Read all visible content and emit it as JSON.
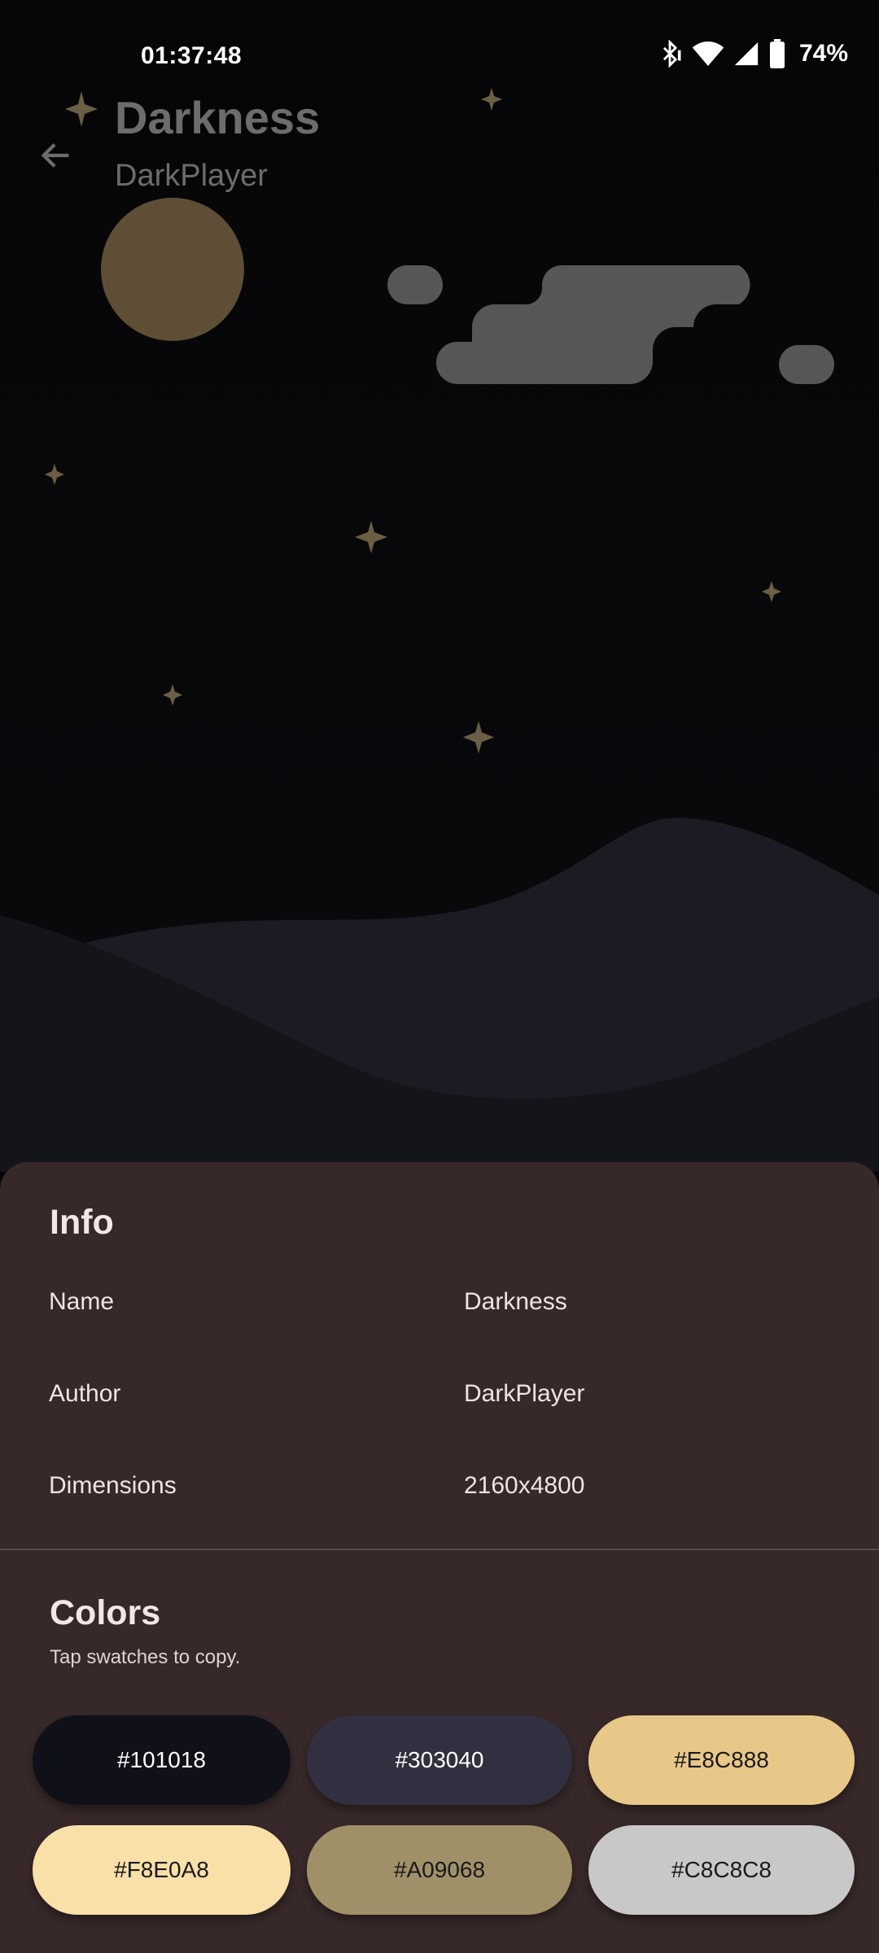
{
  "status_bar": {
    "time": "01:37:48",
    "battery": "74%",
    "icons": [
      "bluetooth-icon",
      "wifi-icon",
      "signal-icon",
      "battery-icon"
    ]
  },
  "header": {
    "back_icon": "arrow-back-icon",
    "title": "Darkness",
    "subtitle": "DarkPlayer"
  },
  "info": {
    "heading": "Info",
    "rows": [
      {
        "label": "Name",
        "value": "Darkness"
      },
      {
        "label": "Author",
        "value": "DarkPlayer"
      },
      {
        "label": "Dimensions",
        "value": "2160x4800"
      }
    ]
  },
  "colors": {
    "heading": "Colors",
    "hint": "Tap swatches to copy.",
    "swatches": [
      {
        "label": "#101018",
        "bg": "#101018",
        "fg": "#ffffff"
      },
      {
        "label": "#303040",
        "bg": "#303040",
        "fg": "#ffffff"
      },
      {
        "label": "#E8C888",
        "bg": "#E8C888",
        "fg": "#1a1a1a"
      },
      {
        "label": "#F8E0A8",
        "bg": "#F8E0A8",
        "fg": "#1a1a1a"
      },
      {
        "label": "#A09068",
        "bg": "#A09068",
        "fg": "#1a1a1a"
      },
      {
        "label": "#C8C8C8",
        "bg": "#C8C8C8",
        "fg": "#1a1a1a"
      }
    ]
  },
  "theme": {
    "sheet_bg": "#372829",
    "moon": "#5e4e36",
    "cloud": "#565656",
    "star": "#6a5e44",
    "hill_back": "#1b1b23",
    "hill_front": "#14141b"
  }
}
